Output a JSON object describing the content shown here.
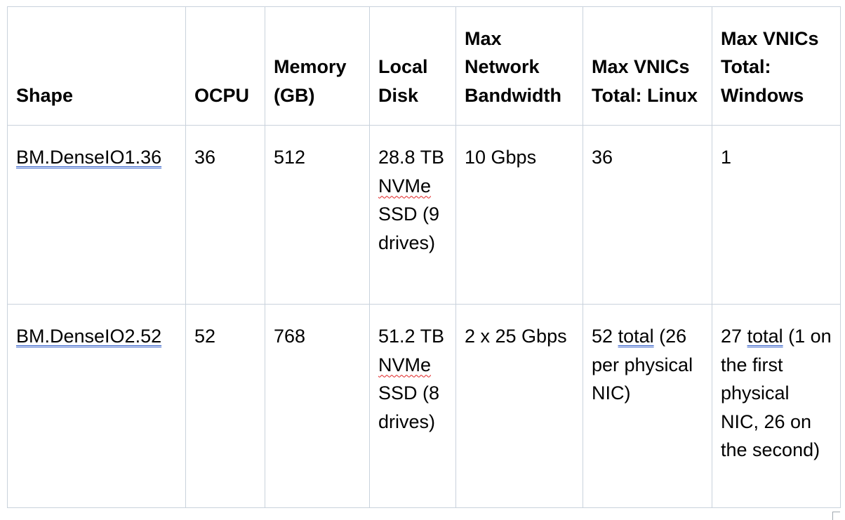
{
  "table": {
    "headers": {
      "shape": "Shape",
      "ocpu": "OCPU",
      "memory": "Memory (GB)",
      "local_disk": "Local Disk",
      "bandwidth": "Max Network Bandwidth",
      "vnics_linux": "Max VNICs Total: Linux",
      "vnics_windows": "Max VNICs Total: Windows"
    },
    "rows": [
      {
        "shape": "BM.DenseIO1.36",
        "ocpu": "36",
        "memory": "512",
        "disk_size": "28.8 TB",
        "disk_type": "NVMe",
        "disk_rest": "SSD (9 drives)",
        "bandwidth": "10 Gbps",
        "vnics_linux": "36",
        "vnics_windows": "1"
      },
      {
        "shape": "BM.DenseIO2.52",
        "ocpu": "52",
        "memory": "768",
        "disk_size": "51.2 TB",
        "disk_type": "NVMe",
        "disk_rest": "SSD (8 drives)",
        "bandwidth": "2 x 25 Gbps",
        "vnics_linux_num": "52",
        "vnics_linux_total": "total",
        "vnics_linux_rest": "(26 per physical NIC)",
        "vnics_windows_num": "27",
        "vnics_windows_total": "total",
        "vnics_windows_rest": "(1 on the first physical NIC, 26 on the second)"
      }
    ]
  }
}
